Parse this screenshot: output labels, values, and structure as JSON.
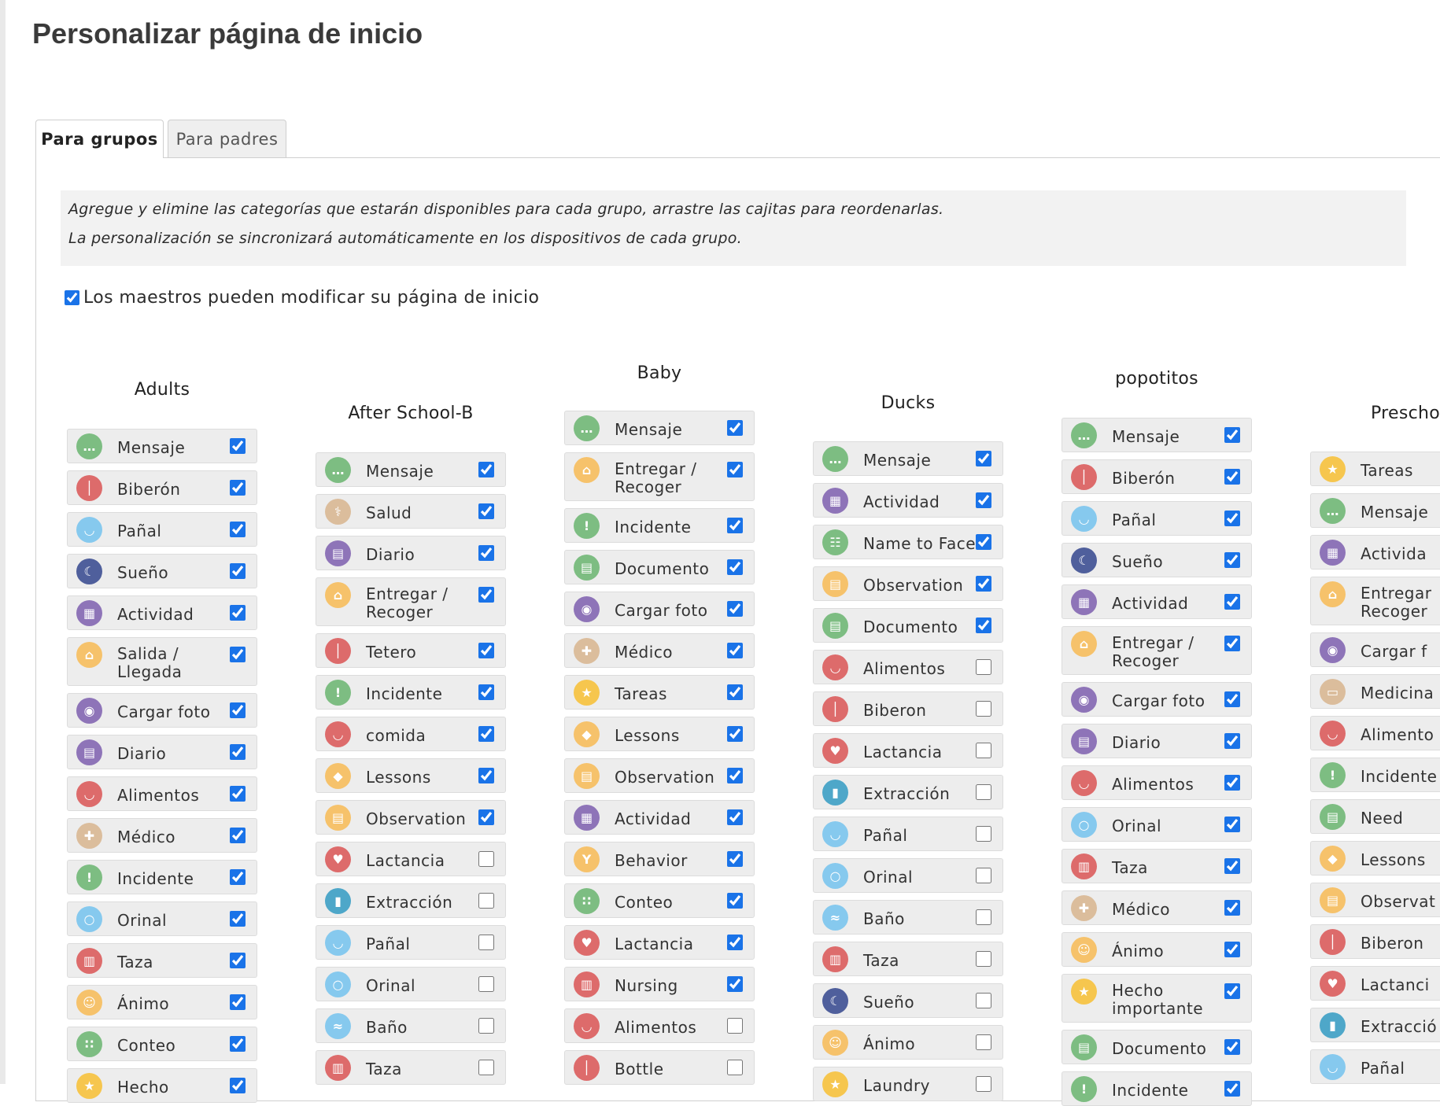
{
  "page_title": "Personalizar página de inicio",
  "tabs": [
    {
      "label": "Para grupos",
      "active": true
    },
    {
      "label": "Para padres",
      "active": false
    }
  ],
  "info_lines": [
    "Agregue y elimine las categorías que estarán disponibles para cada grupo, arrastre las cajitas para reordenarlas.",
    "La personalización se sincronizará automáticamente en los dispositivos de cada grupo."
  ],
  "teachers_can_modify": {
    "label": "Los maestros pueden modificar su página de inicio",
    "checked": true
  },
  "icon_colors": {
    "green": "#7dbd82",
    "red": "#dd6b6b",
    "lightblue": "#86c9ee",
    "navy": "#4f5f9c",
    "purple": "#8e74b8",
    "orange": "#f6c26b",
    "tan": "#dbbd9c",
    "teal": "#4ea7c9",
    "blue": "#5b8fd1",
    "yellow": "#f6c64e"
  },
  "checkbox_accent": "#1a73e8",
  "groups": [
    {
      "name": "Adults",
      "items": [
        {
          "label": "Mensaje",
          "icon": "message-icon",
          "color": "green",
          "checked": true
        },
        {
          "label": "Biberón",
          "icon": "bottle-icon",
          "color": "red",
          "checked": true
        },
        {
          "label": "Pañal",
          "icon": "diaper-icon",
          "color": "lightblue",
          "checked": true
        },
        {
          "label": "Sueño",
          "icon": "sleep-moon-icon",
          "color": "navy",
          "checked": true
        },
        {
          "label": "Actividad",
          "icon": "blocks-icon",
          "color": "purple",
          "checked": true
        },
        {
          "label": "Salida /\nLlegada",
          "icon": "house-icon",
          "color": "orange",
          "checked": true
        },
        {
          "label": "Cargar foto",
          "icon": "camera-icon",
          "color": "purple",
          "checked": true
        },
        {
          "label": "Diario",
          "icon": "journal-icon",
          "color": "purple",
          "checked": true
        },
        {
          "label": "Alimentos",
          "icon": "food-bowl-icon",
          "color": "red",
          "checked": true
        },
        {
          "label": "Médico",
          "icon": "doctor-icon",
          "color": "tan",
          "checked": true
        },
        {
          "label": "Incidente",
          "icon": "warning-icon",
          "color": "green",
          "checked": true
        },
        {
          "label": "Orinal",
          "icon": "potty-icon",
          "color": "lightblue",
          "checked": true
        },
        {
          "label": "Taza",
          "icon": "sippy-cup-icon",
          "color": "red",
          "checked": true
        },
        {
          "label": "Ánimo",
          "icon": "mood-face-icon",
          "color": "orange",
          "checked": true
        },
        {
          "label": "Conteo",
          "icon": "counting-icon",
          "color": "green",
          "checked": true
        },
        {
          "label": "Hecho",
          "icon": "star-icon",
          "color": "yellow",
          "checked": true
        }
      ]
    },
    {
      "name": "After School-B",
      "items": [
        {
          "label": "Mensaje",
          "icon": "message-icon",
          "color": "green",
          "checked": true
        },
        {
          "label": "Salud",
          "icon": "stethoscope-icon",
          "color": "tan",
          "checked": true
        },
        {
          "label": "Diario",
          "icon": "journal-icon",
          "color": "purple",
          "checked": true
        },
        {
          "label": "Entregar /\nRecoger",
          "icon": "house-icon",
          "color": "orange",
          "checked": true
        },
        {
          "label": "Tetero",
          "icon": "bottle-icon",
          "color": "red",
          "checked": true
        },
        {
          "label": "Incidente",
          "icon": "warning-icon",
          "color": "green",
          "checked": true
        },
        {
          "label": "comida",
          "icon": "food-bowl-icon",
          "color": "red",
          "checked": true
        },
        {
          "label": "Lessons",
          "icon": "graduation-cap-icon",
          "color": "orange",
          "checked": true
        },
        {
          "label": "Observation",
          "icon": "observation-icon",
          "color": "orange",
          "checked": true
        },
        {
          "label": "Lactancia",
          "icon": "nursing-icon",
          "color": "red",
          "checked": false
        },
        {
          "label": "Extracción",
          "icon": "pump-icon",
          "color": "teal",
          "checked": false
        },
        {
          "label": "Pañal",
          "icon": "diaper-icon",
          "color": "lightblue",
          "checked": false
        },
        {
          "label": "Orinal",
          "icon": "potty-icon",
          "color": "lightblue",
          "checked": false
        },
        {
          "label": "Baño",
          "icon": "bath-icon",
          "color": "lightblue",
          "checked": false
        },
        {
          "label": "Taza",
          "icon": "sippy-cup-icon",
          "color": "red",
          "checked": false
        }
      ]
    },
    {
      "name": "Baby",
      "items": [
        {
          "label": "Mensaje",
          "icon": "message-icon",
          "color": "green",
          "checked": true
        },
        {
          "label": "Entregar /\nRecoger",
          "icon": "house-icon",
          "color": "orange",
          "checked": true
        },
        {
          "label": "Incidente",
          "icon": "warning-icon",
          "color": "green",
          "checked": true
        },
        {
          "label": "Documento",
          "icon": "document-icon",
          "color": "green",
          "checked": true
        },
        {
          "label": "Cargar foto",
          "icon": "camera-icon",
          "color": "purple",
          "checked": true
        },
        {
          "label": "Médico",
          "icon": "doctor-icon",
          "color": "tan",
          "checked": true
        },
        {
          "label": "Tareas",
          "icon": "star-icon",
          "color": "yellow",
          "checked": true
        },
        {
          "label": "Lessons",
          "icon": "graduation-cap-icon",
          "color": "orange",
          "checked": true
        },
        {
          "label": "Observation",
          "icon": "observation-icon",
          "color": "orange",
          "checked": true
        },
        {
          "label": "Actividad",
          "icon": "blocks-icon",
          "color": "purple",
          "checked": true
        },
        {
          "label": "Behavior",
          "icon": "behavior-icon",
          "color": "orange",
          "checked": true
        },
        {
          "label": "Conteo",
          "icon": "counting-icon",
          "color": "green",
          "checked": true
        },
        {
          "label": "Lactancia",
          "icon": "nursing-icon",
          "color": "red",
          "checked": true
        },
        {
          "label": "Nursing",
          "icon": "sippy-cup-icon",
          "color": "red",
          "checked": true
        },
        {
          "label": "Alimentos",
          "icon": "food-bowl-icon",
          "color": "red",
          "checked": false
        },
        {
          "label": "Bottle",
          "icon": "bottle-icon",
          "color": "red",
          "checked": false
        }
      ]
    },
    {
      "name": "Ducks",
      "items": [
        {
          "label": "Mensaje",
          "icon": "message-icon",
          "color": "green",
          "checked": true
        },
        {
          "label": "Actividad",
          "icon": "blocks-icon",
          "color": "purple",
          "checked": true
        },
        {
          "label": "Name to Face",
          "icon": "name-to-face-icon",
          "color": "green",
          "checked": true
        },
        {
          "label": "Observation",
          "icon": "observation-icon",
          "color": "orange",
          "checked": true
        },
        {
          "label": "Documento",
          "icon": "document-icon",
          "color": "green",
          "checked": true
        },
        {
          "label": "Alimentos",
          "icon": "food-bowl-icon",
          "color": "red",
          "checked": false
        },
        {
          "label": "Biberon",
          "icon": "bottle-icon",
          "color": "red",
          "checked": false
        },
        {
          "label": "Lactancia",
          "icon": "nursing-icon",
          "color": "red",
          "checked": false
        },
        {
          "label": "Extracción",
          "icon": "pump-icon",
          "color": "teal",
          "checked": false
        },
        {
          "label": "Pañal",
          "icon": "diaper-icon",
          "color": "lightblue",
          "checked": false
        },
        {
          "label": "Orinal",
          "icon": "potty-icon",
          "color": "lightblue",
          "checked": false
        },
        {
          "label": "Baño",
          "icon": "bath-icon",
          "color": "lightblue",
          "checked": false
        },
        {
          "label": "Taza",
          "icon": "sippy-cup-icon",
          "color": "red",
          "checked": false
        },
        {
          "label": "Sueño",
          "icon": "sleep-moon-icon",
          "color": "navy",
          "checked": false
        },
        {
          "label": "Ánimo",
          "icon": "mood-face-icon",
          "color": "orange",
          "checked": false
        },
        {
          "label": "Laundry",
          "icon": "star-icon",
          "color": "yellow",
          "checked": false
        }
      ]
    },
    {
      "name": "popotitos",
      "items": [
        {
          "label": "Mensaje",
          "icon": "message-icon",
          "color": "green",
          "checked": true
        },
        {
          "label": "Biberón",
          "icon": "bottle-icon",
          "color": "red",
          "checked": true
        },
        {
          "label": "Pañal",
          "icon": "diaper-icon",
          "color": "lightblue",
          "checked": true
        },
        {
          "label": "Sueño",
          "icon": "sleep-moon-icon",
          "color": "navy",
          "checked": true
        },
        {
          "label": "Actividad",
          "icon": "blocks-icon",
          "color": "purple",
          "checked": true
        },
        {
          "label": "Entregar /\nRecoger",
          "icon": "house-icon",
          "color": "orange",
          "checked": true
        },
        {
          "label": "Cargar foto",
          "icon": "camera-icon",
          "color": "purple",
          "checked": true
        },
        {
          "label": "Diario",
          "icon": "journal-icon",
          "color": "purple",
          "checked": true
        },
        {
          "label": "Alimentos",
          "icon": "food-bowl-icon",
          "color": "red",
          "checked": true
        },
        {
          "label": "Orinal",
          "icon": "potty-icon",
          "color": "lightblue",
          "checked": true
        },
        {
          "label": "Taza",
          "icon": "sippy-cup-icon",
          "color": "red",
          "checked": true
        },
        {
          "label": "Médico",
          "icon": "doctor-icon",
          "color": "tan",
          "checked": true
        },
        {
          "label": "Ánimo",
          "icon": "mood-face-icon",
          "color": "orange",
          "checked": true
        },
        {
          "label": "Hecho\nimportante",
          "icon": "star-icon",
          "color": "yellow",
          "checked": true
        },
        {
          "label": "Documento",
          "icon": "document-icon",
          "color": "green",
          "checked": true
        },
        {
          "label": "Incidente",
          "icon": "warning-icon",
          "color": "green",
          "checked": true
        }
      ]
    },
    {
      "name": "Prescho",
      "items": [
        {
          "label": "Tareas",
          "icon": "star-icon",
          "color": "yellow",
          "checked": true
        },
        {
          "label": "Mensaje",
          "icon": "message-icon",
          "color": "green",
          "checked": true
        },
        {
          "label": "Activida",
          "icon": "blocks-icon",
          "color": "purple",
          "checked": true
        },
        {
          "label": "Entregar\nRecoger",
          "icon": "house-icon",
          "color": "orange",
          "checked": true
        },
        {
          "label": "Cargar f",
          "icon": "camera-icon",
          "color": "purple",
          "checked": true
        },
        {
          "label": "Medicina",
          "icon": "medicine-icon",
          "color": "tan",
          "checked": true
        },
        {
          "label": "Alimento",
          "icon": "food-bowl-icon",
          "color": "red",
          "checked": true
        },
        {
          "label": "Incidente",
          "icon": "warning-icon",
          "color": "green",
          "checked": true
        },
        {
          "label": "Need",
          "icon": "document-icon",
          "color": "green",
          "checked": true
        },
        {
          "label": "Lessons",
          "icon": "graduation-cap-icon",
          "color": "orange",
          "checked": true
        },
        {
          "label": "Observat",
          "icon": "observation-icon",
          "color": "orange",
          "checked": true
        },
        {
          "label": "Biberon",
          "icon": "bottle-icon",
          "color": "red",
          "checked": true
        },
        {
          "label": "Lactanci",
          "icon": "nursing-icon",
          "color": "red",
          "checked": true
        },
        {
          "label": "Extracció",
          "icon": "pump-icon",
          "color": "teal",
          "checked": true
        },
        {
          "label": "Pañal",
          "icon": "diaper-icon",
          "color": "lightblue",
          "checked": true
        }
      ]
    }
  ]
}
